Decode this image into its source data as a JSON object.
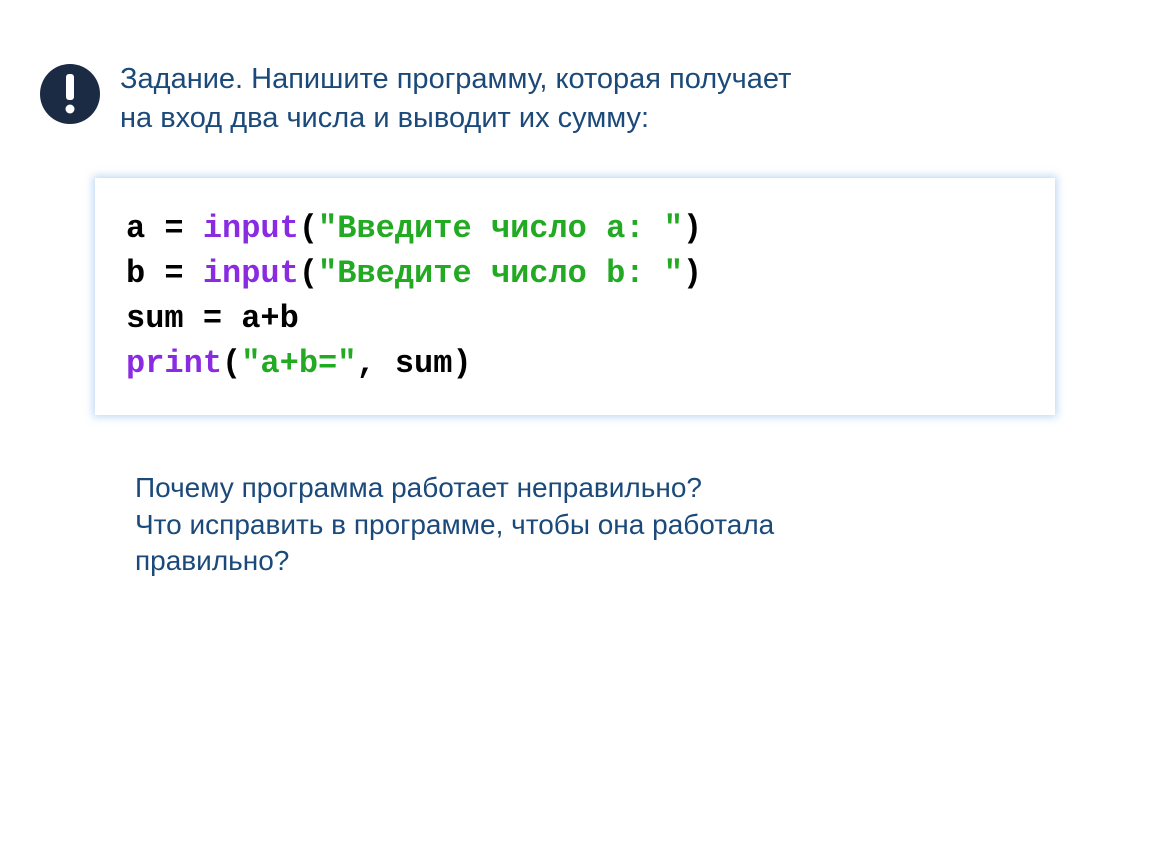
{
  "header": {
    "line1": "Задание. Напишите программу, которая получает",
    "line2": "на вход два числа и выводит их сумму:"
  },
  "code": {
    "line1": {
      "t1": "a = ",
      "t2": "input",
      "t3": "(",
      "t4": "\"Введите число a: \"",
      "t5": ")"
    },
    "line2": {
      "t1": "b = ",
      "t2": "input",
      "t3": "(",
      "t4": "\"Введите число b: \"",
      "t5": ")"
    },
    "line3": {
      "t1": "sum = a+b"
    },
    "line4": {
      "t1": "print",
      "t2": "(",
      "t3": "\"a+b=\"",
      "t4": ", sum)"
    }
  },
  "question": {
    "line1": "Почему программа работает неправильно?",
    "line2": "Что исправить в программе, чтобы она работала",
    "line3": "правильно?"
  }
}
